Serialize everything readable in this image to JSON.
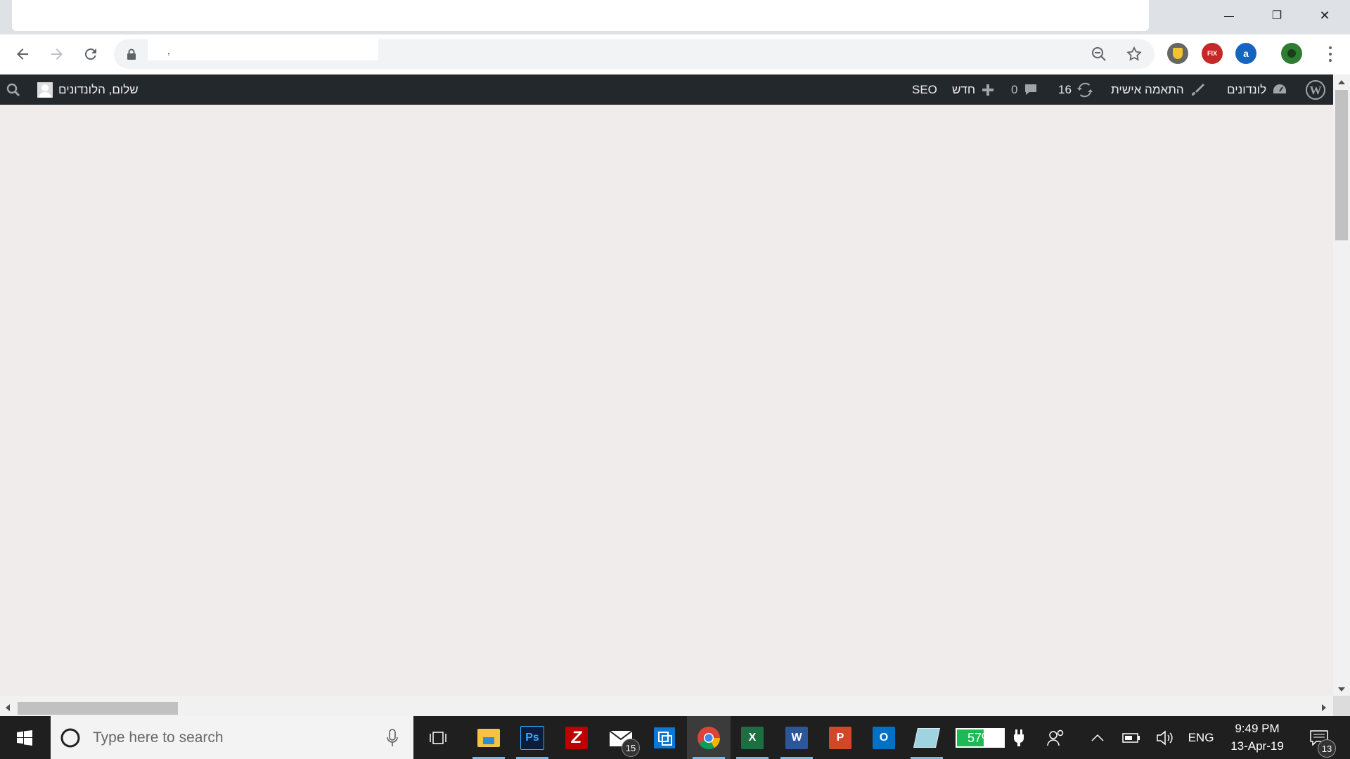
{
  "browser": {
    "minimize_glyph": "—",
    "restore_glyph": "❐",
    "close_glyph": "✕",
    "omnibox_text": ","
  },
  "adminbar": {
    "site_name": "לונדונים",
    "customize": "התאמה אישית",
    "updates_count": "16",
    "comments_count": "0",
    "new_label": "חדש",
    "seo_label": "SEO",
    "greeting": "שלום, הלונדונים"
  },
  "taskbar": {
    "search_placeholder": "Type here to search",
    "mail_badge": "15",
    "battery_percent": "57%",
    "language": "ENG",
    "time": "9:49 PM",
    "date": "13-Apr-19",
    "notifications_count": "13",
    "apps": {
      "photoshop": "Ps",
      "excel": "X",
      "word": "W",
      "powerpoint": "P",
      "outlook": "O"
    }
  },
  "colors": {
    "adminbar_bg": "#23282d",
    "page_bg": "#f1ecec",
    "taskbar_bg": "#1f1f1f",
    "battery_green": "#1db954"
  }
}
